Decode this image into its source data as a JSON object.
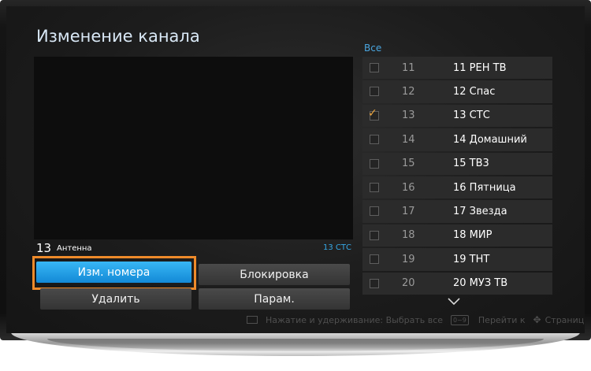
{
  "page_title": "Изменение канала",
  "preview": {
    "channel_number": "13",
    "source": "Антенна",
    "channel_name": "13 СТС"
  },
  "buttons": {
    "edit_number": "Изм. номера",
    "lock": "Блокировка",
    "delete": "Удалить",
    "options": "Парам."
  },
  "list_header": "Все",
  "channels": [
    {
      "num": "11",
      "name": "11 РЕН ТВ",
      "checked": false
    },
    {
      "num": "12",
      "name": "12 Спас",
      "checked": false
    },
    {
      "num": "13",
      "name": "13 СТС",
      "checked": true
    },
    {
      "num": "14",
      "name": "14 Домашний",
      "checked": false
    },
    {
      "num": "15",
      "name": "15 ТВ3",
      "checked": false
    },
    {
      "num": "16",
      "name": "16 Пятница",
      "checked": false
    },
    {
      "num": "17",
      "name": "17 Звезда",
      "checked": false
    },
    {
      "num": "18",
      "name": "18 МИР",
      "checked": false
    },
    {
      "num": "19",
      "name": "19 ТНТ",
      "checked": false
    },
    {
      "num": "20",
      "name": "20 МУЗ ТВ",
      "checked": false
    }
  ],
  "footer": {
    "hold_select_all": "Нажатие и удерживание: Выбрать все",
    "keys": "0~9",
    "goto": "Перейти к",
    "page": "Страница"
  },
  "icons": {
    "scroll": "chevron-down-icon",
    "checkmark": "checkmark-icon"
  },
  "colors": {
    "active_button": "#1e9be6",
    "focus_outline": "#ee8a2a",
    "accent_text": "#35a8e6",
    "checkmark": "#e9a33d"
  }
}
